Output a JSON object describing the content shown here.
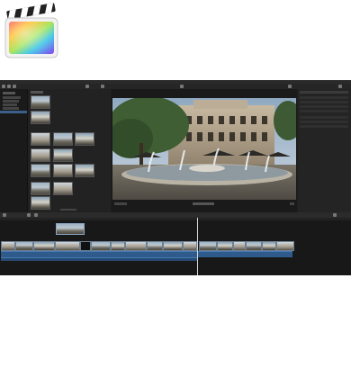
{
  "app": {
    "name": "Final Cut Pro",
    "logo_icon": "final-cut-pro-clapper-icon"
  },
  "colors": {
    "window_bg": "#1e1e1e",
    "selection": "#3b5f8a",
    "audio_waveform": "#2e5a8c",
    "playhead": "#d9d9d9"
  }
}
